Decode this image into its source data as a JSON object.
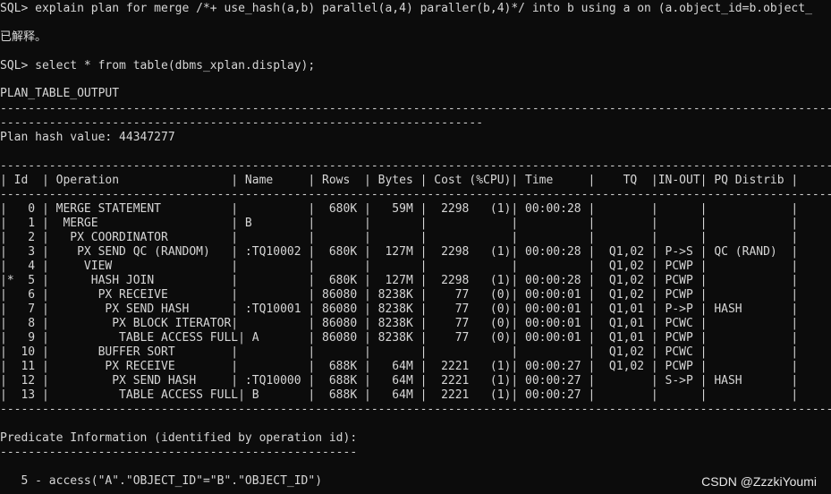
{
  "terminal": {
    "lines": {
      "cmd1": "SQL> explain plan for merge /*+ use_hash(a,b) parallel(a,4) paraller(b,4)*/ into b using a on (a.object_id=b.object_",
      "explained": "已解释。",
      "cmd2": "SQL> select * from table(dbms_xplan.display);",
      "plan_header": "PLAN_TABLE_OUTPUT",
      "sep_long": "---------------------------------------------------------------------------------------------------------------------------------------",
      "sep_short": "---------------------------------------------------------------------",
      "plan_hash": "Plan hash value: 44347277",
      "sep_table": "---------------------------------------------------------------------------------------------------------------------------------------",
      "table_header": "| Id  | Operation                | Name     | Rows  | Bytes | Cost (%CPU)| Time     |    TQ  |IN-OUT| PQ Distrib |",
      "sep_table2": "---------------------------------------------------------------------------------------------------------------------------------------",
      "rows": [
        "|   0 | MERGE STATEMENT          |          |  680K |   59M |  2298   (1)| 00:00:28 |        |      |            |",
        "|   1 |  MERGE                   | B        |       |       |            |          |        |      |            |",
        "|   2 |   PX COORDINATOR         |          |       |       |            |          |        |      |            |",
        "|   3 |    PX SEND QC (RANDOM)   | :TQ10002 |  680K |  127M |  2298   (1)| 00:00:28 |  Q1,02 | P->S | QC (RAND)  |",
        "|   4 |     VIEW                 |          |       |       |            |          |  Q1,02 | PCWP |            |",
        "|*  5 |      HASH JOIN           |          |  680K |  127M |  2298   (1)| 00:00:28 |  Q1,02 | PCWP |            |",
        "|   6 |       PX RECEIVE         |          | 86080 | 8238K |    77   (0)| 00:00:01 |  Q1,02 | PCWP |            |",
        "|   7 |        PX SEND HASH      | :TQ10001 | 86080 | 8238K |    77   (0)| 00:00:01 |  Q1,01 | P->P | HASH       |",
        "|   8 |         PX BLOCK ITERATOR|          | 86080 | 8238K |    77   (0)| 00:00:01 |  Q1,01 | PCWC |            |",
        "|   9 |          TABLE ACCESS FULL| A       | 86080 | 8238K |    77   (0)| 00:00:01 |  Q1,01 | PCWP |            |",
        "|  10 |       BUFFER SORT        |          |       |       |            |          |  Q1,02 | PCWC |            |",
        "|  11 |        PX RECEIVE        |          |  688K |   64M |  2221   (1)| 00:00:27 |  Q1,02 | PCWP |            |",
        "|  12 |         PX SEND HASH     | :TQ10000 |  688K |   64M |  2221   (1)| 00:00:27 |        | S->P | HASH       |",
        "|  13 |          TABLE ACCESS FULL| B       |  688K |   64M |  2221   (1)| 00:00:27 |        |      |            |"
      ],
      "sep_end": "---------------------------------------------------------------------------------------------------------------------------------------",
      "predicate_title": "Predicate Information (identified by operation id):",
      "predicate_sep": "---------------------------------------------------",
      "predicate_line": "   5 - access(\"A\".\"OBJECT_ID\"=\"B\".\"OBJECT_ID\")"
    },
    "watermark": "CSDN @ZzzkiYoumi"
  }
}
